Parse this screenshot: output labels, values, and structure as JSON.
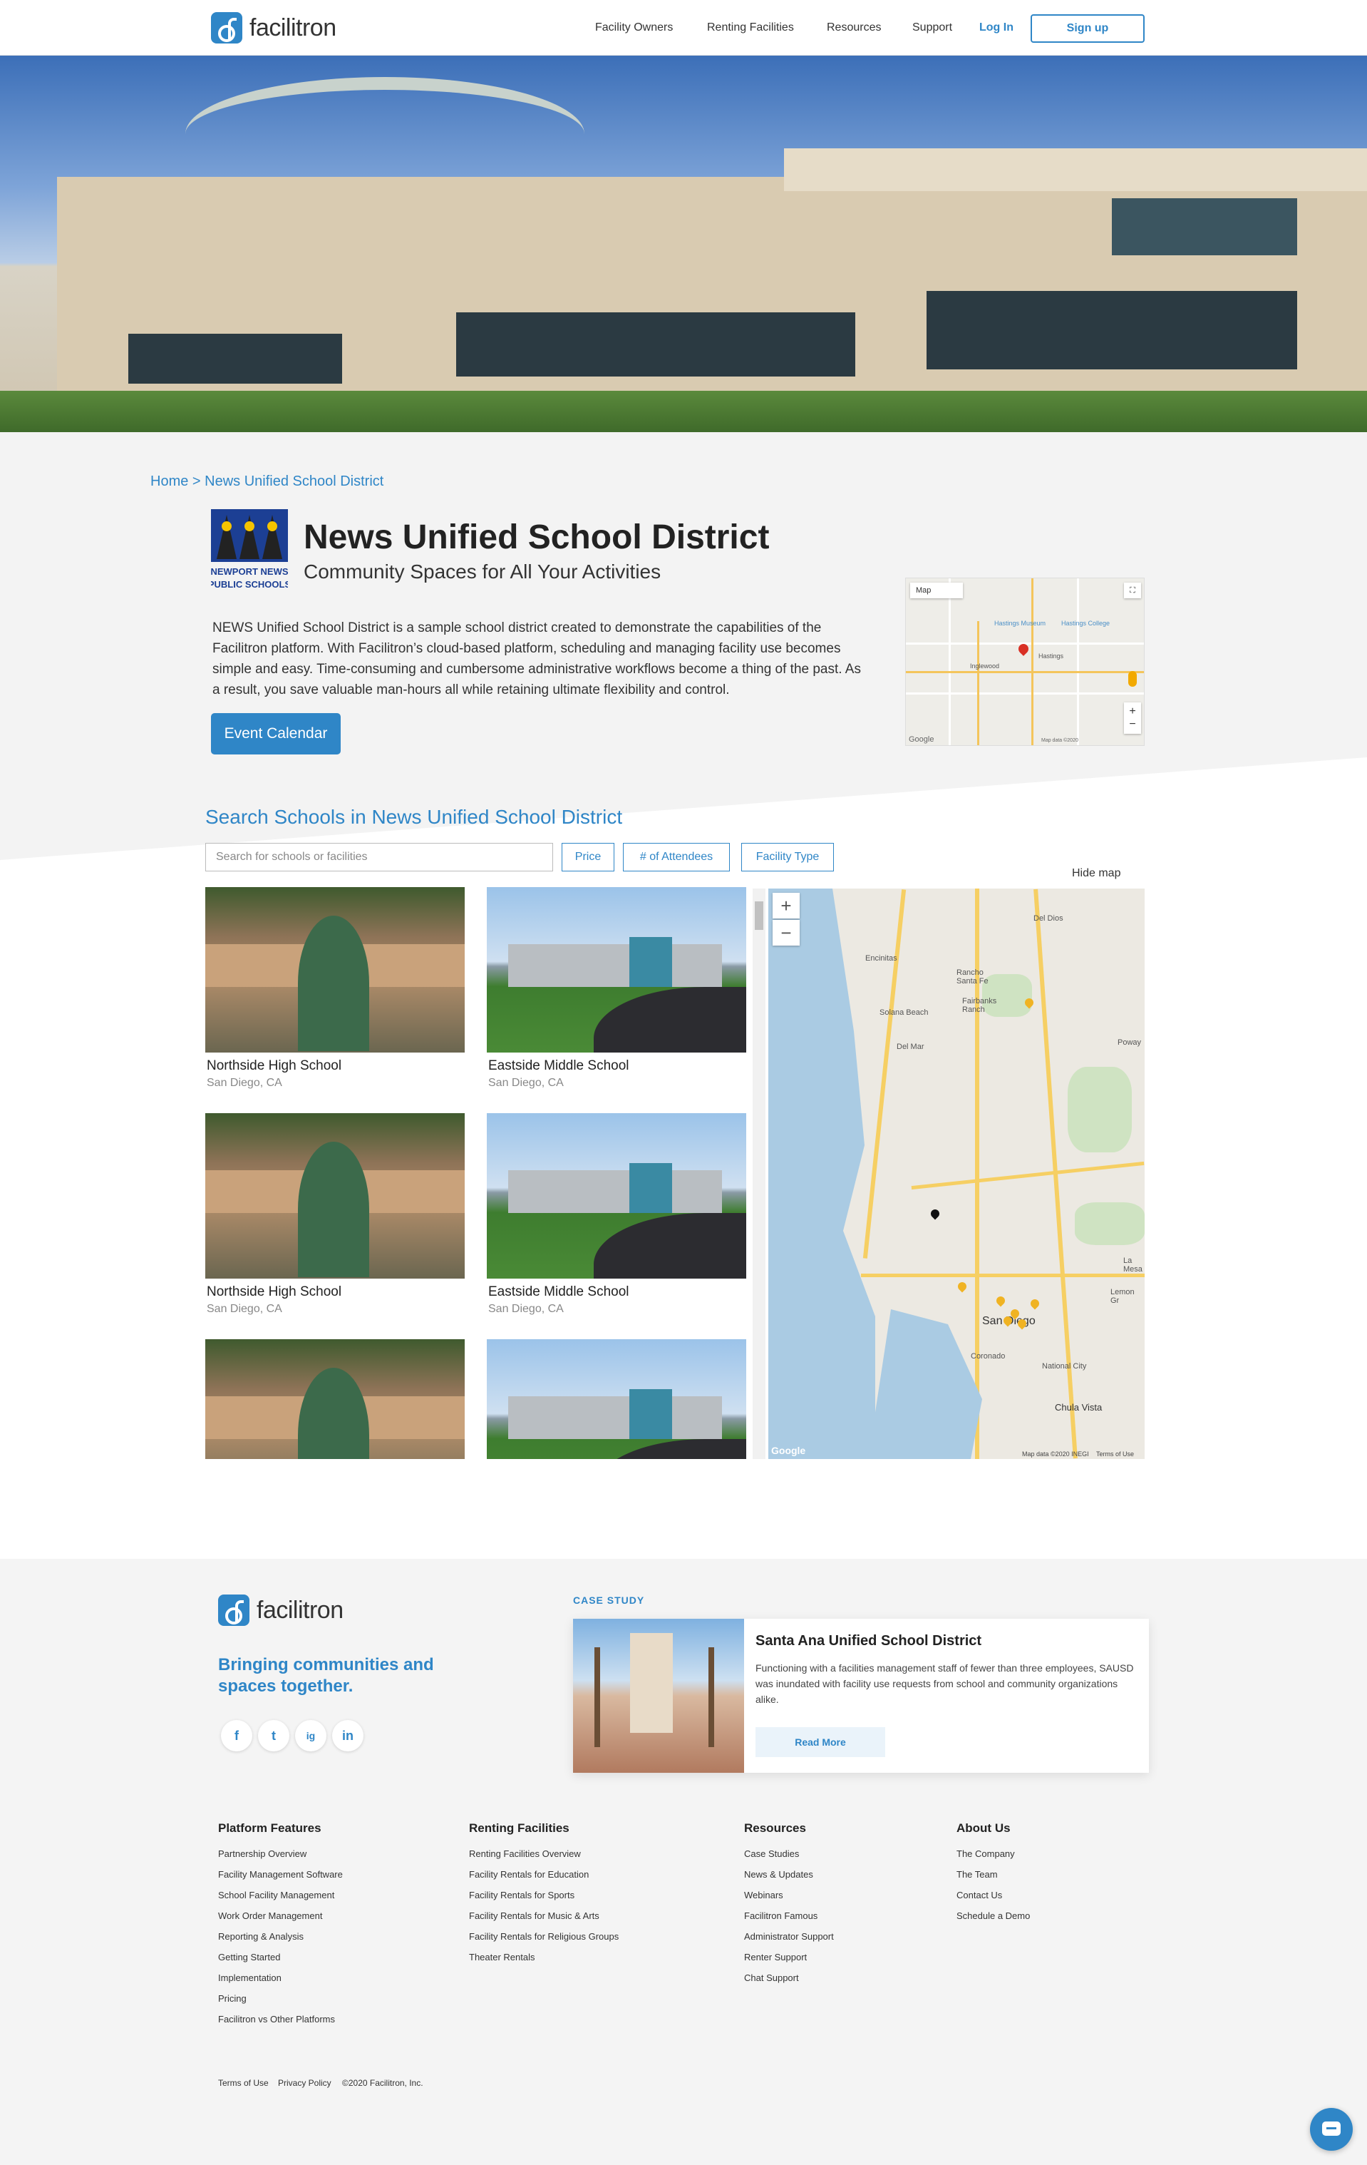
{
  "header": {
    "brand": "facilitron",
    "nav": [
      "Facility Owners",
      "Renting Facilities",
      "Resources",
      "Support"
    ],
    "login": "Log In",
    "signup": "Sign up"
  },
  "breadcrumb": "Home > News Unified School District",
  "district": {
    "logo_text": "NEWPORT NEWS PUBLIC SCHOOLS",
    "title": "News Unified School District",
    "subtitle": "Community Spaces for All Your Activities",
    "description": "NEWS Unified School District is a sample school district created to demonstrate the capabilities of the Facilitron platform. With Facilitron’s cloud-based platform, scheduling and managing facility use becomes simple and easy. Time-consuming and cumbersome administrative workflows become a thing of the past. As a result, you save valuable man-hours all while retaining ultimate flexibility and control.",
    "event_button": "Event Calendar"
  },
  "mini_map": {
    "type_label": "Map",
    "labels": [
      "Hastings Museum",
      "Hastings College",
      "Hastings",
      "Inglewood"
    ],
    "attribution": "Map data ©2020",
    "logo": "Google"
  },
  "search": {
    "title": "Search Schools in News Unified School District",
    "placeholder": "Search for schools or facilities",
    "filters": [
      "Price",
      "# of Attendees",
      "Facility Type"
    ],
    "hide_map": "Hide map"
  },
  "results": [
    {
      "name": "Northside High School",
      "location": "San Diego, CA"
    },
    {
      "name": "Eastside Middle School",
      "location": "San Diego, CA"
    },
    {
      "name": "Northside High School",
      "location": "San Diego, CA"
    },
    {
      "name": "Eastside Middle School",
      "location": "San Diego, CA"
    },
    {
      "name": "",
      "location": ""
    },
    {
      "name": "",
      "location": ""
    }
  ],
  "big_map": {
    "places": [
      "Del Dios",
      "Encinitas",
      "Rancho Santa Fe",
      "Fairbanks Ranch",
      "Solana Beach",
      "Del Mar",
      "Poway",
      "San Diego",
      "Coronado",
      "National City",
      "Chula Vista",
      "La Mesa",
      "Lemon Gr"
    ],
    "logo": "Google",
    "attribution": "Map data ©2020 INEGI",
    "terms": "Terms of Use"
  },
  "footer": {
    "brand": "facilitron",
    "tagline": "Bringing communities and spaces together.",
    "social": [
      "f",
      "t",
      "ig",
      "in"
    ],
    "case_label": "CASE STUDY",
    "case_title": "Santa Ana Unified School District",
    "case_text": "Functioning with a facilities management staff of fewer than three employees, SAUSD was inundated with facility use requests from school and community organizations alike.",
    "read_more": "Read More",
    "columns": [
      {
        "title": "Platform Features",
        "items": [
          "Partnership Overview",
          "Facility Management Software",
          "School Facility Management",
          "Work Order Management",
          "Reporting & Analysis",
          "Getting Started",
          "Implementation",
          "Pricing",
          "Facilitron vs Other Platforms"
        ]
      },
      {
        "title": "Renting Facilities",
        "items": [
          "Renting Facilities Overview",
          "Facility Rentals for Education",
          "Facility Rentals for Sports",
          "Facility Rentals for Music & Arts",
          "Facility Rentals for Religious Groups",
          "Theater Rentals"
        ]
      },
      {
        "title": "Resources",
        "items": [
          "Case Studies",
          "News & Updates",
          "Webinars",
          "Facilitron Famous",
          "Administrator Support",
          "Renter Support",
          "Chat Support"
        ]
      },
      {
        "title": "About Us",
        "items": [
          "The Company",
          "The Team",
          "Contact Us",
          "Schedule a Demo"
        ]
      }
    ],
    "legal": [
      "Terms of Use",
      "Privacy Policy",
      "©2020 Facilitron, Inc."
    ]
  },
  "colors": {
    "accent": "#2f86c7",
    "footer_bg": "#f4f4f4"
  }
}
